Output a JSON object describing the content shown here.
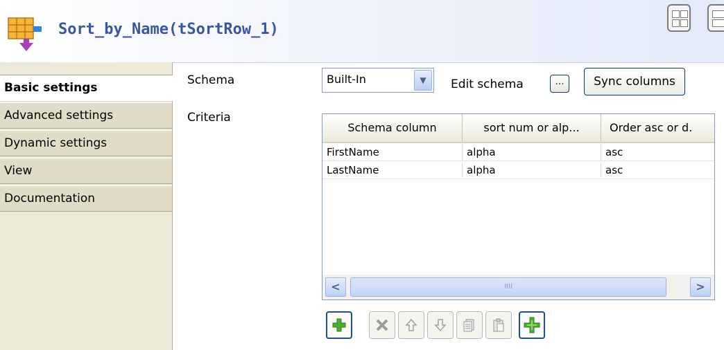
{
  "header": {
    "title": "Sort_by_Name(tSortRow_1)",
    "icon": "tsortrow-component-icon",
    "layout_buttons": [
      "grid-layout-icon",
      "list-layout-icon"
    ]
  },
  "sidebar": {
    "tabs": [
      {
        "label": "Basic settings",
        "active": true
      },
      {
        "label": "Advanced settings",
        "active": false
      },
      {
        "label": "Dynamic settings",
        "active": false
      },
      {
        "label": "View",
        "active": false
      },
      {
        "label": "Documentation",
        "active": false
      }
    ]
  },
  "form": {
    "schema_label": "Schema",
    "schema_value": "Built-In",
    "edit_schema_label": "Edit schema",
    "edit_schema_button": "...",
    "sync_columns_label": "Sync columns",
    "criteria_label": "Criteria"
  },
  "criteria_table": {
    "columns": [
      "Schema column",
      "sort num or alp...",
      "Order asc or d."
    ],
    "rows": [
      [
        "FirstName",
        "alpha",
        "asc"
      ],
      [
        "LastName",
        "alpha",
        "asc"
      ]
    ],
    "scroll_left_glyph": "<",
    "scroll_right_glyph": ">",
    "scroll_thumb_grip": "IIII"
  },
  "toolbar": {
    "buttons": [
      {
        "icon": "add-icon",
        "enabled": true
      },
      {
        "icon": "delete-icon",
        "enabled": false
      },
      {
        "icon": "move-up-icon",
        "enabled": false
      },
      {
        "icon": "move-down-icon",
        "enabled": false
      },
      {
        "icon": "copy-icon",
        "enabled": false
      },
      {
        "icon": "paste-icon",
        "enabled": false
      },
      {
        "icon": "add-all-icon",
        "enabled": true
      }
    ]
  },
  "colors": {
    "title": "#3a55a4",
    "sidebar_bg": "#ece9d8",
    "add_green": "#4caf32"
  }
}
